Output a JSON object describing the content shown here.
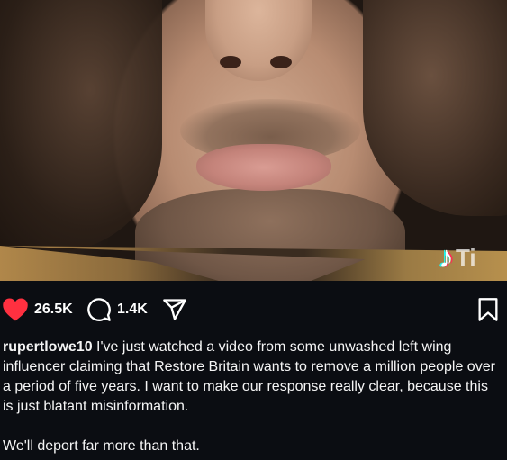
{
  "video": {
    "watermark_text": "Ti",
    "watermark_icon": "tiktok-icon"
  },
  "actions": {
    "like_icon": "heart-icon",
    "like_color": "#ff3040",
    "likes": "26.5K",
    "comment_icon": "comment-icon",
    "comments": "1.4K",
    "share_icon": "send-icon",
    "save_icon": "bookmark-icon"
  },
  "post": {
    "username": "rupertlowe10",
    "caption": "I've just watched a video from some unwashed left wing influencer claiming that Restore Britain wants to remove a million people over a period of five years. I want to make our response really clear, because this is just blatant misinformation.",
    "caption_second": "We'll deport far more than that."
  }
}
